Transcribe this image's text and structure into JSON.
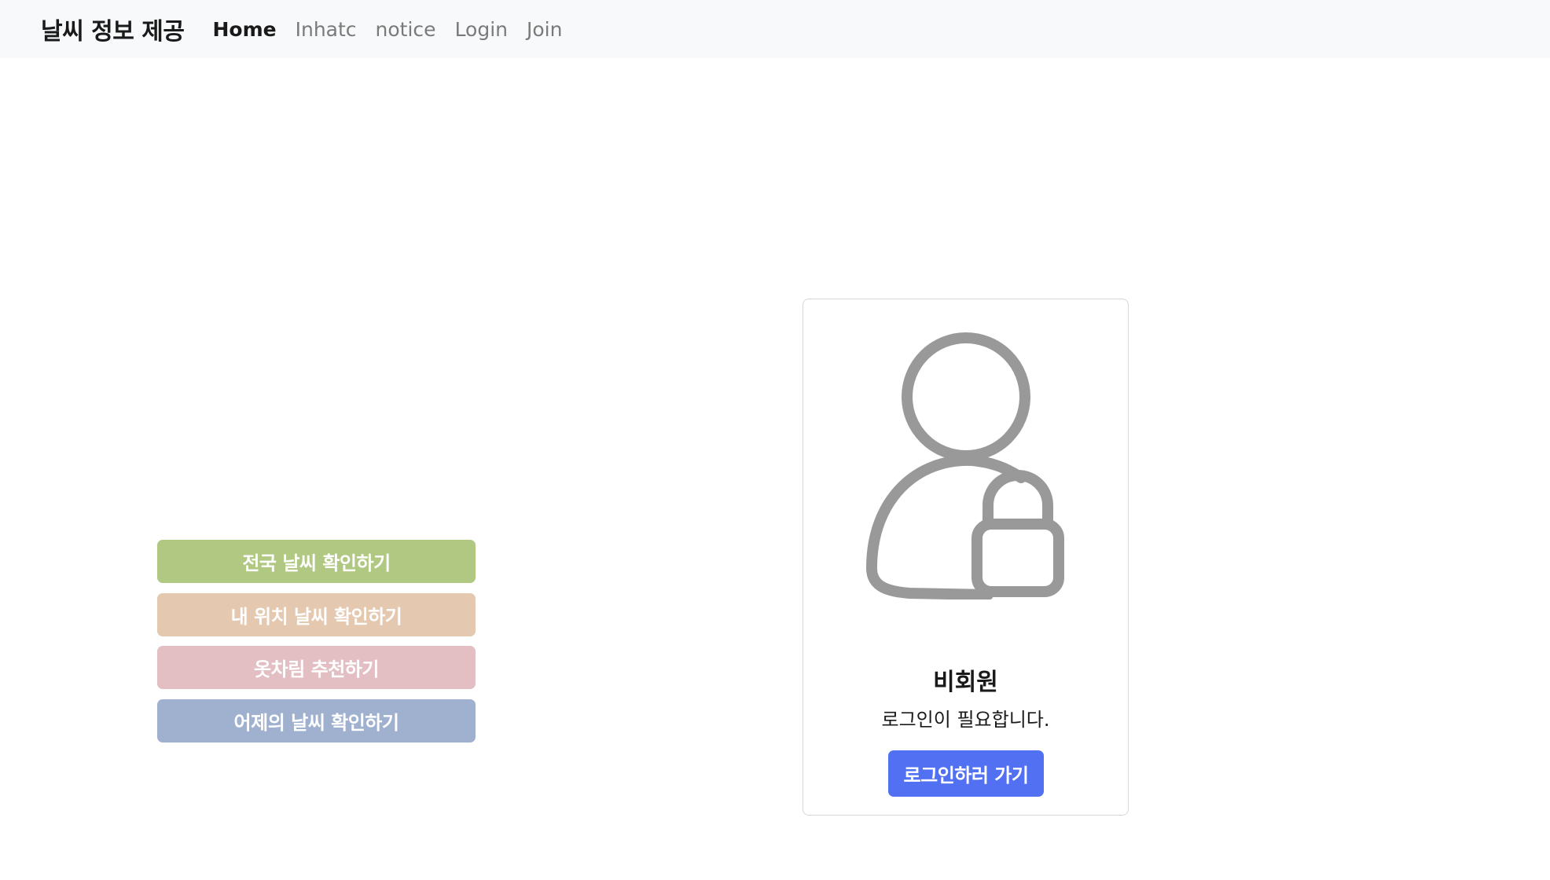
{
  "navbar": {
    "brand": "날씨 정보 제공",
    "links": [
      {
        "label": "Home",
        "active": true
      },
      {
        "label": "Inhatc"
      },
      {
        "label": "notice"
      },
      {
        "label": "Login"
      },
      {
        "label": "Join"
      }
    ]
  },
  "menu": {
    "buttons": [
      {
        "label": "전국 날씨 확인하기",
        "color": "#b0c882"
      },
      {
        "label": "내 위치 날씨 확인하기",
        "color": "#e5c8b0"
      },
      {
        "label": "옷차림 추천하기",
        "color": "#e3bfc4"
      },
      {
        "label": "어제의 날씨 확인하기",
        "color": "#9fb1cf"
      }
    ]
  },
  "card": {
    "icon": "user-lock-icon",
    "icon_color": "#999999",
    "title": "비회원",
    "text": "로그인이 필요합니다.",
    "button_label": "로그인하러 가기",
    "button_color": "#5270f2"
  }
}
